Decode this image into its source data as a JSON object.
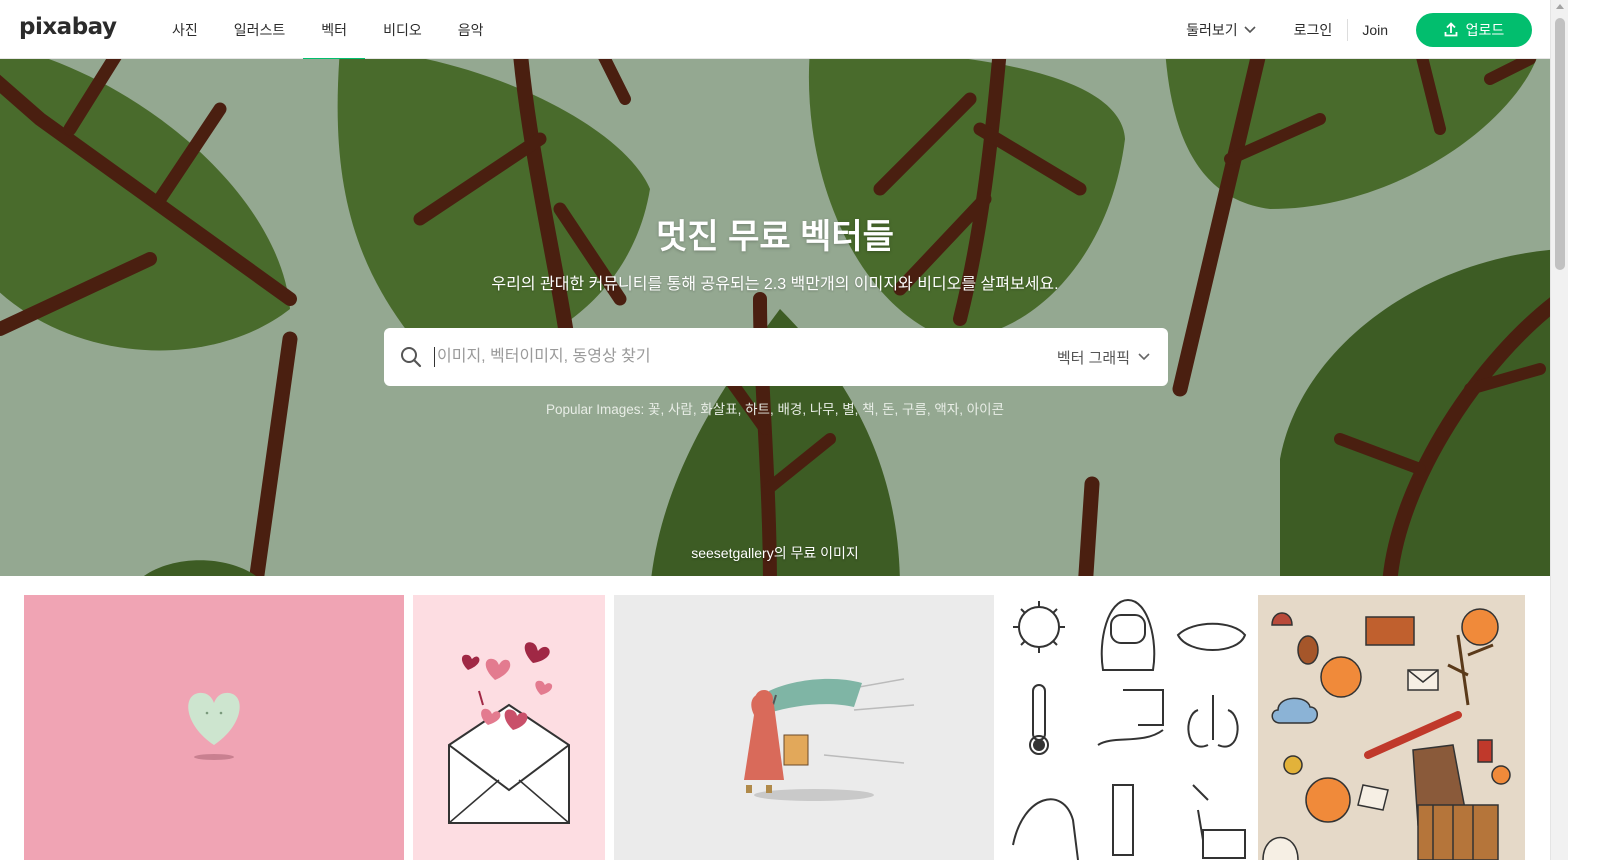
{
  "header": {
    "logo": "pixabay",
    "nav": [
      {
        "label": "사진",
        "active": false
      },
      {
        "label": "일러스트",
        "active": false
      },
      {
        "label": "벡터",
        "active": true
      },
      {
        "label": "비디오",
        "active": false
      },
      {
        "label": "음악",
        "active": false
      }
    ],
    "explore_label": "둘러보기",
    "login_label": "로그인",
    "join_label": "Join",
    "upload_label": "업로드"
  },
  "hero": {
    "title": "멋진 무료 벡터들",
    "subtitle": "우리의 관대한 커뮤니티를 통해 공유되는 2.3 백만개의 이미지와 비디오를 살펴보세요.",
    "search": {
      "placeholder": "이미지, 벡터이미지, 동영상 찾기",
      "type_label": "벡터 그래픽"
    },
    "popular_label": "Popular Images: ",
    "popular_tags": [
      "꽃",
      "사람",
      "화살표",
      "하트",
      "배경",
      "나무",
      "별",
      "책",
      "돈",
      "구름",
      "액자",
      "아이콘"
    ],
    "credit": "seesetgallery의 무료 이미지"
  },
  "colors": {
    "accent": "#02be6e",
    "hero_bg": "#94a891",
    "leaf": "#496b2c",
    "leaf_dark": "#3d5c24",
    "vein": "#4a1f10"
  },
  "icons": {
    "search": "search-icon",
    "chevron": "chevron-down-icon",
    "upload": "upload-icon"
  },
  "gallery": [
    {
      "name": "pink-heart-card"
    },
    {
      "name": "love-letter-card"
    },
    {
      "name": "windy-umbrella-card"
    },
    {
      "name": "covid-doodles-card"
    },
    {
      "name": "autumn-doodles-card"
    }
  ]
}
